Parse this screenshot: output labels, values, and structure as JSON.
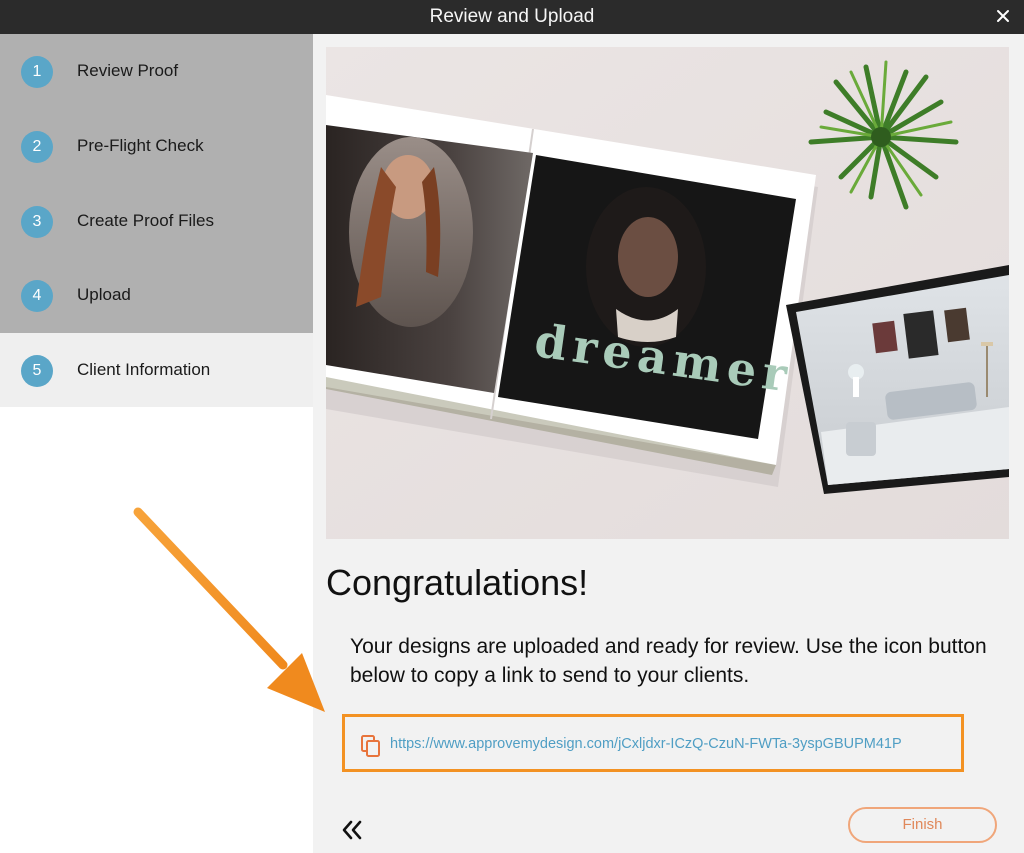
{
  "window": {
    "title": "Review and Upload",
    "close_icon": "close-icon"
  },
  "sidebar": {
    "steps": [
      {
        "number": "1",
        "label": "Review Proof"
      },
      {
        "number": "2",
        "label": "Pre-Flight Check"
      },
      {
        "number": "3",
        "label": "Create Proof Files"
      },
      {
        "number": "4",
        "label": "Upload"
      },
      {
        "number": "5",
        "label": "Client Information"
      }
    ]
  },
  "hero": {
    "book_text": "dreamer"
  },
  "main": {
    "heading": "Congratulations!",
    "description": "Your designs are uploaded and ready for review.  Use the icon button below to copy a link to send to your clients.",
    "link_url": "https://www.approvemydesign.com/jCxljdxr-ICzQ-CzuN-FWTa-3yspGBUPM41P",
    "copy_icon": "copy-icon",
    "back_icon": "double-chevron-left-icon",
    "finish_label": "Finish"
  },
  "colors": {
    "titlebar": "#2b2b2b",
    "step_badge": "#5aa6c8",
    "highlight": "#f39223",
    "link": "#4f9ec4",
    "finish": "#e0885a"
  }
}
